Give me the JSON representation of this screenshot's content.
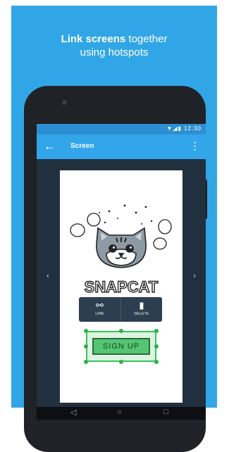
{
  "headline": {
    "bold": "Link screens",
    "line1_rest": " together",
    "line2": "using hotspots"
  },
  "statusbar": {
    "icons": "▼◢▮",
    "time": "12:30"
  },
  "appbar": {
    "back_icon": "arrow-back-icon",
    "title": "Screen",
    "menu_icon": "more-vert-icon"
  },
  "navigation": {
    "prev": "‹",
    "next": "›"
  },
  "canvas": {
    "logo_text": "SNAPCAT",
    "toolbar": {
      "link_label": "LINK",
      "delete_label": "DELETE"
    },
    "signup_label": "SIGN UP"
  },
  "colors": {
    "background": "#31a6e6",
    "appbar": "#33a5ea",
    "hotspot": "#3bc45a",
    "toolbar": "#2c3e50"
  }
}
